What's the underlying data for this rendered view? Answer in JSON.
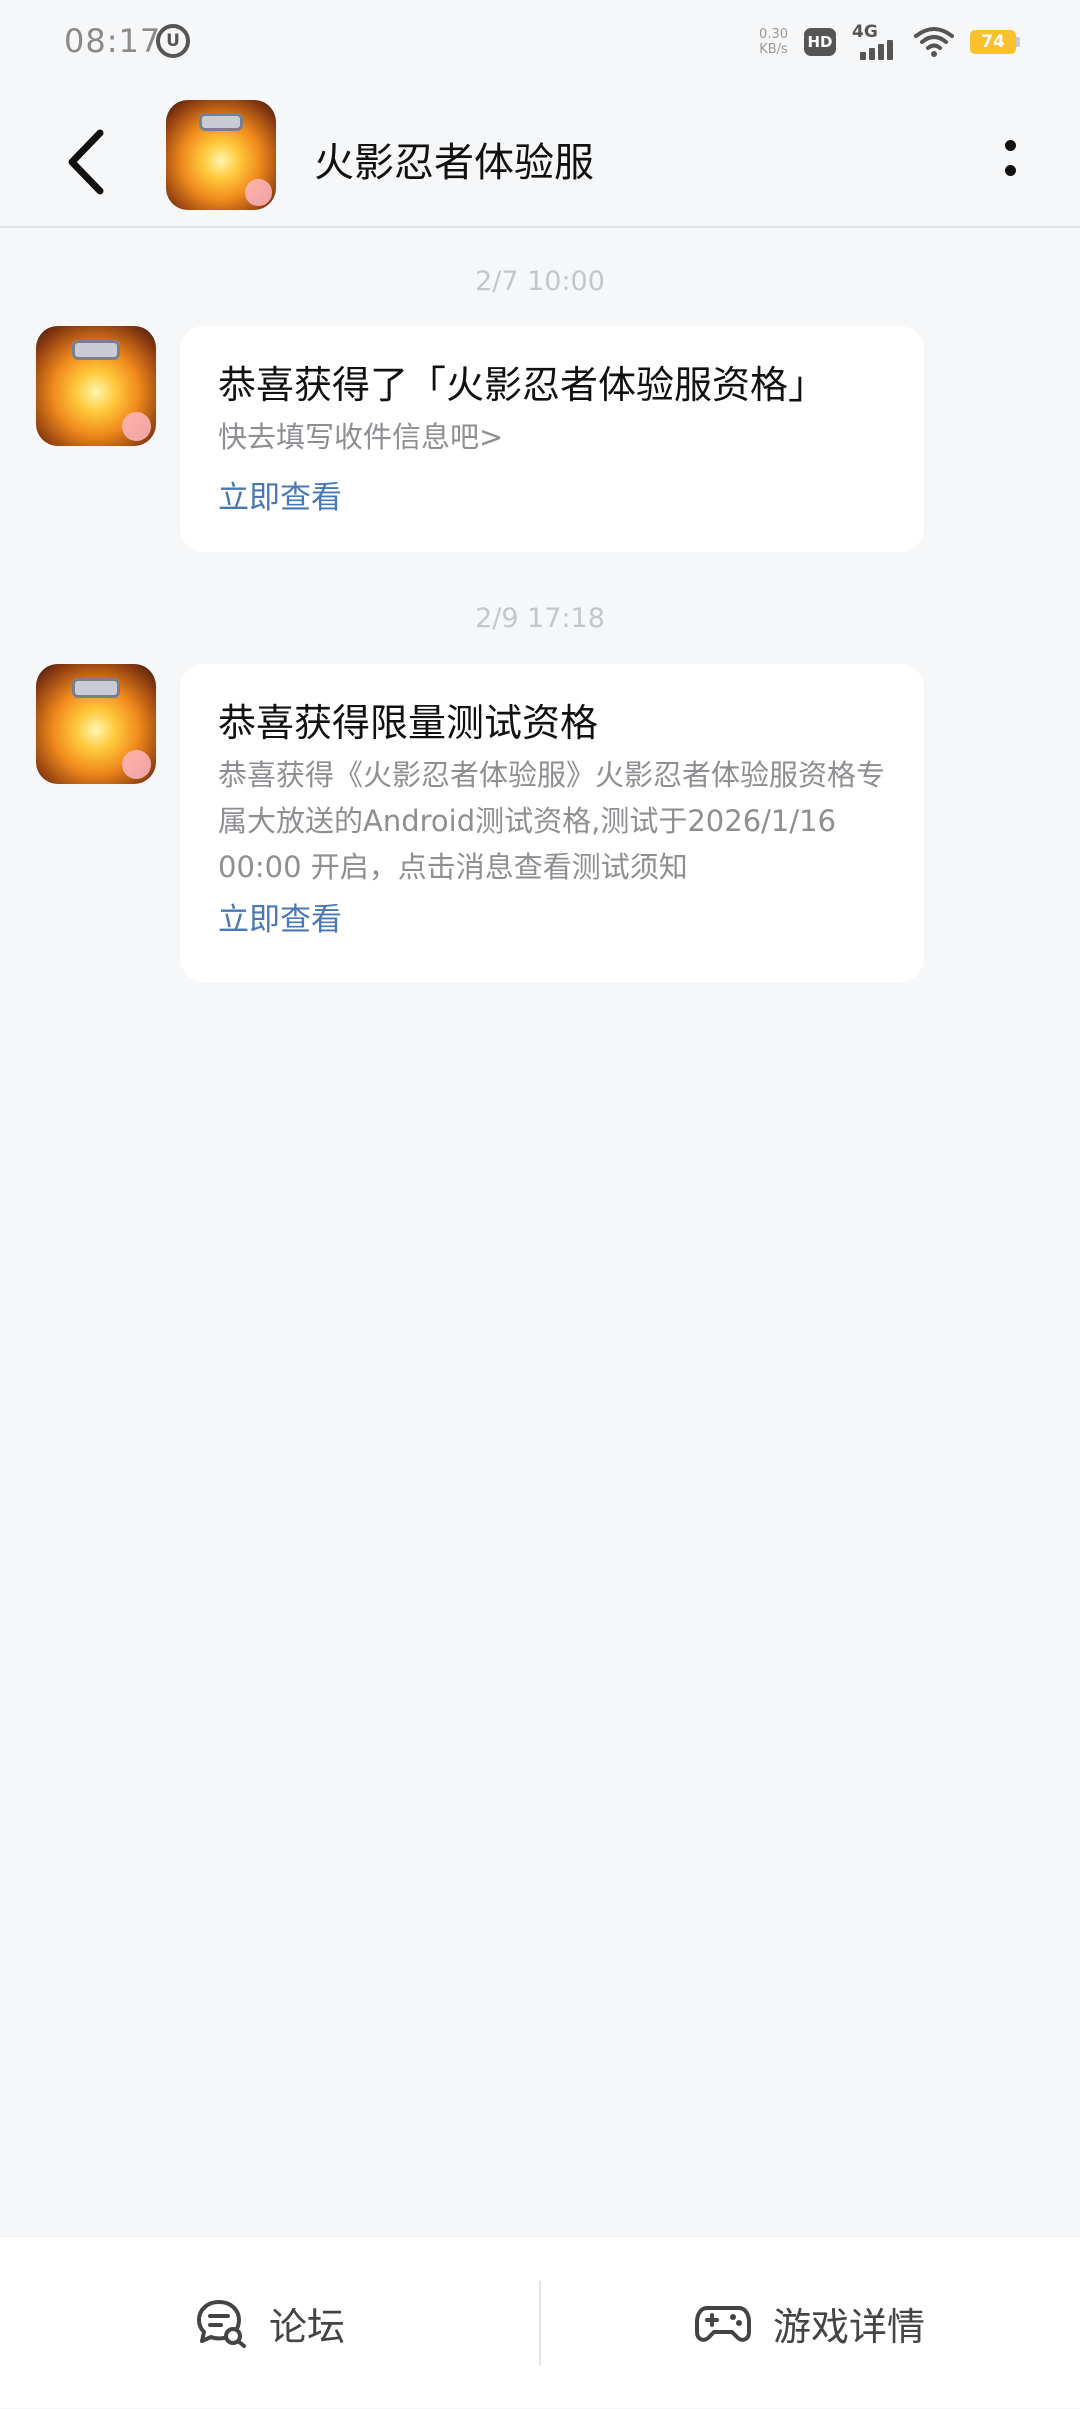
{
  "status_bar": {
    "time": "08:17",
    "app_badge": "U",
    "net_speed_value": "0.30",
    "net_speed_unit": "KB/s",
    "hd": "HD",
    "network": "4G",
    "battery": "74",
    "battery_color": "#fbc02d"
  },
  "header": {
    "title": "火影忍者体验服",
    "back_icon": "chevron-left-icon",
    "more_icon": "more-vertical-icon"
  },
  "messages": [
    {
      "timestamp": "2/7 10:00",
      "title": "恭喜获得了「火影忍者体验服资格」",
      "body": "快去填写收件信息吧>",
      "link": "立即查看"
    },
    {
      "timestamp": "2/9 17:18",
      "title": "恭喜获得限量测试资格",
      "body": "恭喜获得《火影忍者体验服》火影忍者体验服资格专属大放送的Android测试资格,测试于2026/1/16 00:00 开启，点击消息查看测试须知",
      "link": "立即查看"
    }
  ],
  "bottom_bar": {
    "forum_label": "论坛",
    "forum_icon": "forum-chat-icon",
    "game_label": "游戏详情",
    "game_icon": "gamepad-icon"
  },
  "colors": {
    "background": "#f6f7f9",
    "link": "#4a78b4",
    "timestamp": "#c4c6cb"
  }
}
